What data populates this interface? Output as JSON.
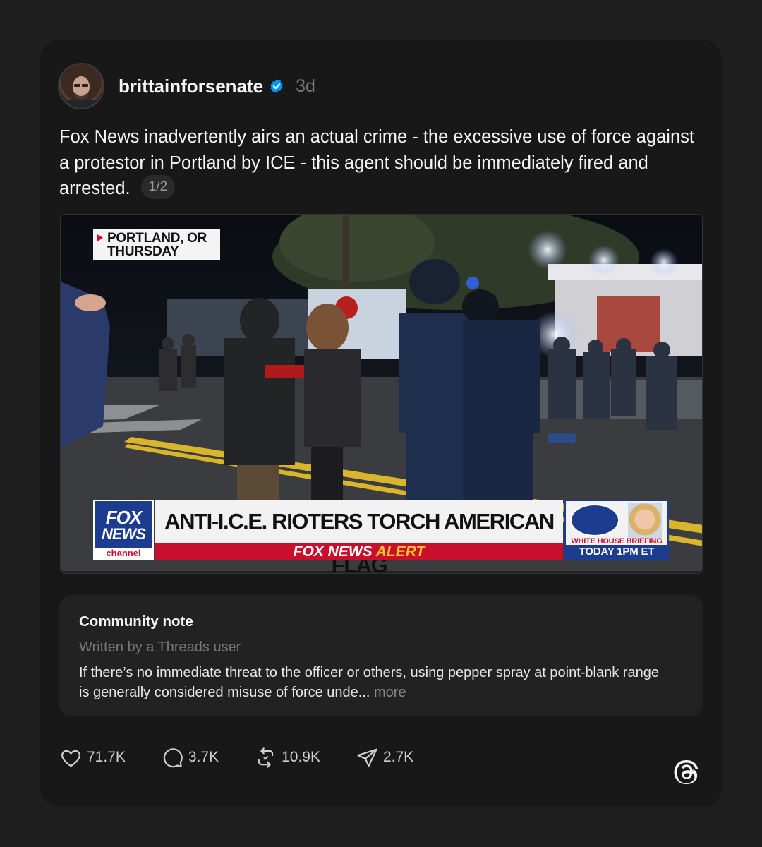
{
  "post": {
    "username": "brittainforsenate",
    "timestamp": "3d",
    "text": "Fox News inadvertently airs an actual crime - the excessive use of force against a protestor in Portland by ICE - this agent should be immediately fired and arrested.",
    "page_count": "1/2"
  },
  "media": {
    "location_line1": "PORTLAND, OR",
    "location_line2": "THURSDAY",
    "logo_line1": "FOX",
    "logo_line2": "NEWS",
    "logo_line3": "channel",
    "headline": "ANTI-I.C.E. RIOTERS TORCH AMERICAN FLAG",
    "alert_part1": "FOX NEWS",
    "alert_part2": "ALERT",
    "promo_line1": "WHITE HOUSE BRIEFING",
    "promo_line2": "TODAY 1PM ET"
  },
  "community_note": {
    "title": "Community note",
    "subtitle": "Written by a Threads user",
    "body": "If there’s no immediate threat to the officer or others, using pepper spray at point-blank range is generally considered misuse of force unde...",
    "more_label": "more"
  },
  "actions": {
    "likes": "71.7K",
    "replies": "3.7K",
    "reposts": "10.9K",
    "shares": "2.7K"
  },
  "icons": {
    "verified": "verified-badge-icon",
    "like": "heart-icon",
    "reply": "comment-icon",
    "repost": "repost-icon",
    "share": "send-icon",
    "brand": "threads-logo-icon"
  },
  "colors": {
    "card_bg": "#181818",
    "verified_blue": "#0095f6",
    "fox_red": "#c8102e",
    "fox_blue": "#1c3c8f"
  }
}
